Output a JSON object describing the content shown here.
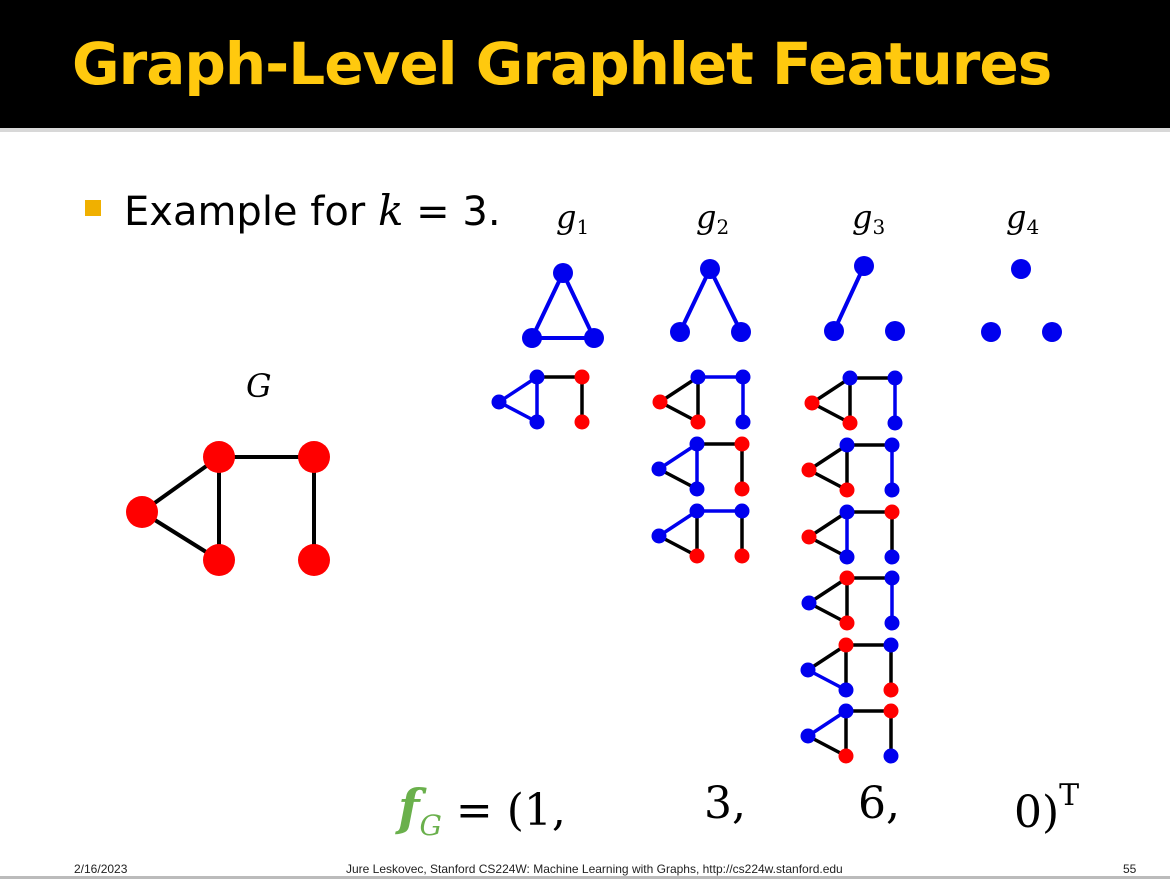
{
  "slide": {
    "title": "Graph-Level Graphlet Features",
    "bullet_prefix": "Example for ",
    "bullet_var": "k",
    "bullet_suffix": " = 3.",
    "graph_label": "G",
    "graphlets": [
      {
        "name": "g",
        "sub": "1",
        "count": "1,"
      },
      {
        "name": "g",
        "sub": "2",
        "count": "3,"
      },
      {
        "name": "g",
        "sub": "3",
        "count": "6,"
      },
      {
        "name": "g",
        "sub": "4",
        "count": "0)"
      }
    ],
    "formula": {
      "vector": "f",
      "vector_sub": "G",
      "equals_open": "= (",
      "transpose": "T"
    },
    "footer": {
      "date": "2/16/2023",
      "credit": "Jure Leskovec, Stanford CS224W: Machine Learning with Graphs, http://cs224w.stanford.edu",
      "page": "55"
    },
    "colors": {
      "title": "#ffc90e",
      "node_red": "#ff0000",
      "node_blue": "#0000ee",
      "edge_black": "#000000",
      "vector_green": "#6ab04c"
    }
  }
}
